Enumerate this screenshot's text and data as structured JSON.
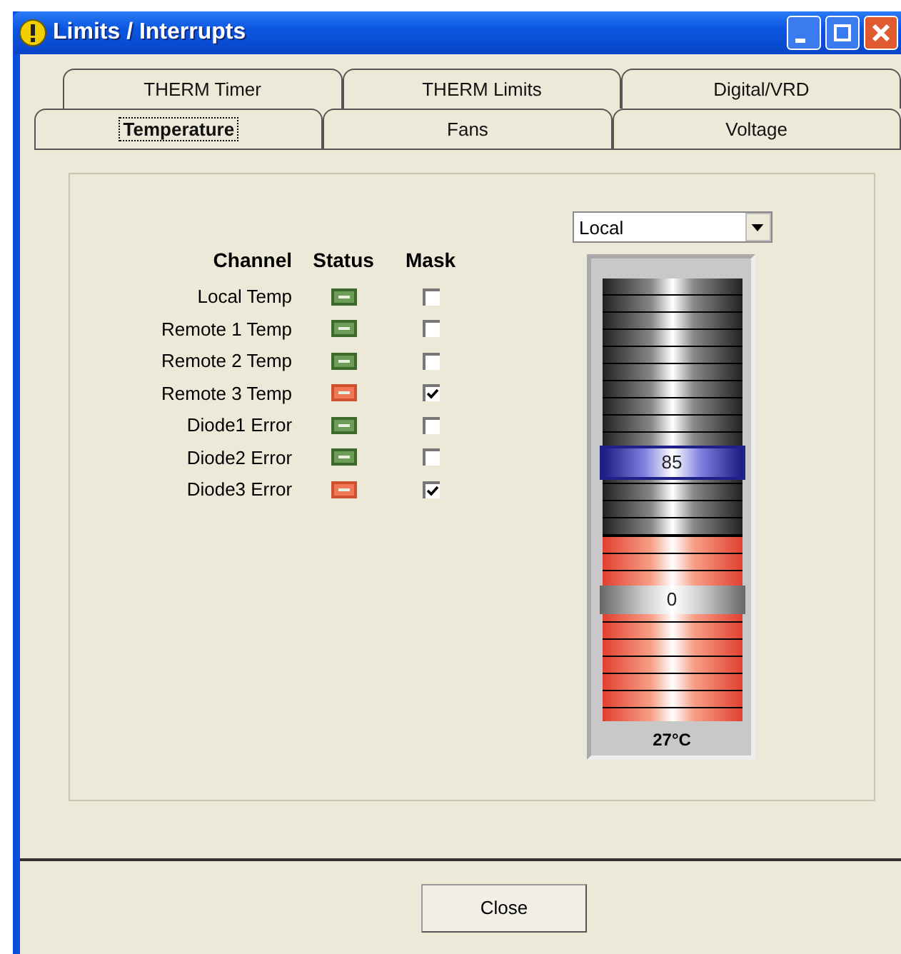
{
  "window": {
    "title": "Limits / Interrupts"
  },
  "tab_rows": [
    [
      {
        "label": "THERM Timer",
        "selected": false
      },
      {
        "label": "THERM Limits",
        "selected": false
      },
      {
        "label": "Digital/VRD",
        "selected": false
      }
    ],
    [
      {
        "label": "Temperature",
        "selected": true
      },
      {
        "label": "Fans",
        "selected": false
      },
      {
        "label": "Voltage",
        "selected": false
      }
    ]
  ],
  "table": {
    "columns": [
      "Channel",
      "Status",
      "Mask"
    ],
    "rows": [
      {
        "channel": "Local Temp",
        "alarm": false,
        "masked": false
      },
      {
        "channel": "Remote 1 Temp",
        "alarm": false,
        "masked": false
      },
      {
        "channel": "Remote 2 Temp",
        "alarm": false,
        "masked": false
      },
      {
        "channel": "Remote 3 Temp",
        "alarm": true,
        "masked": true
      },
      {
        "channel": "Diode1 Error",
        "alarm": false,
        "masked": false
      },
      {
        "channel": "Diode2 Error",
        "alarm": false,
        "masked": false
      },
      {
        "channel": "Diode3 Error",
        "alarm": true,
        "masked": true
      }
    ]
  },
  "channel_select": {
    "value": "Local"
  },
  "gauge": {
    "level": 0.42,
    "high_limit": "85",
    "low_limit": "0",
    "reading": "27°C"
  },
  "buttons": [
    "Close"
  ]
}
